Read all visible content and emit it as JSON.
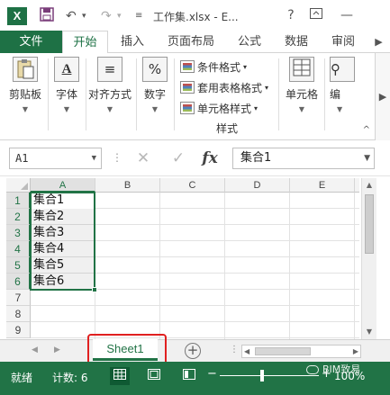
{
  "titlebar": {
    "app_logo": "X",
    "title": "工作集.xlsx - E...",
    "help_label": "?",
    "icons": [
      "save-icon",
      "undo-icon",
      "redo-icon",
      "customize-icon",
      "help-icon",
      "ribbon-display-icon",
      "minimize-icon"
    ]
  },
  "tabs": {
    "file": "文件",
    "items": [
      "开始",
      "插入",
      "页面布局",
      "公式",
      "数据",
      "审阅"
    ],
    "active": "开始"
  },
  "ribbon": {
    "clipboard": "剪贴板",
    "font": "字体",
    "alignment": "对齐方式",
    "number": "数字",
    "conditional_format": "条件格式",
    "format_as_table": "套用表格格式",
    "cell_styles": "单元格样式",
    "styles_group": "样式",
    "cells": "单元格",
    "editing": "编",
    "font_icon_glyph": "A",
    "percent_glyph": "%"
  },
  "formula_bar": {
    "name_box": "A1",
    "fx_label": "fx",
    "content": "集合1"
  },
  "grid": {
    "columns": [
      "A",
      "B",
      "C",
      "D",
      "E"
    ],
    "rows": [
      "1",
      "2",
      "3",
      "4",
      "5",
      "6",
      "7",
      "8",
      "9"
    ],
    "selected_column": "A",
    "selected_rows": [
      "1",
      "2",
      "3",
      "4",
      "5",
      "6"
    ],
    "cells_a": [
      "集合1",
      "集合2",
      "集合3",
      "集合4",
      "集合5",
      "集合6"
    ]
  },
  "sheets": {
    "tabs": [
      "Sheet1"
    ],
    "active": "Sheet1",
    "add_label": "+"
  },
  "status": {
    "ready": "就绪",
    "count": "计数: 6",
    "zoom": "100%",
    "watermark": "BIM致易"
  },
  "colors": {
    "brand": "#217346",
    "file_tab": "#1e7145",
    "highlight": "#e02020"
  }
}
